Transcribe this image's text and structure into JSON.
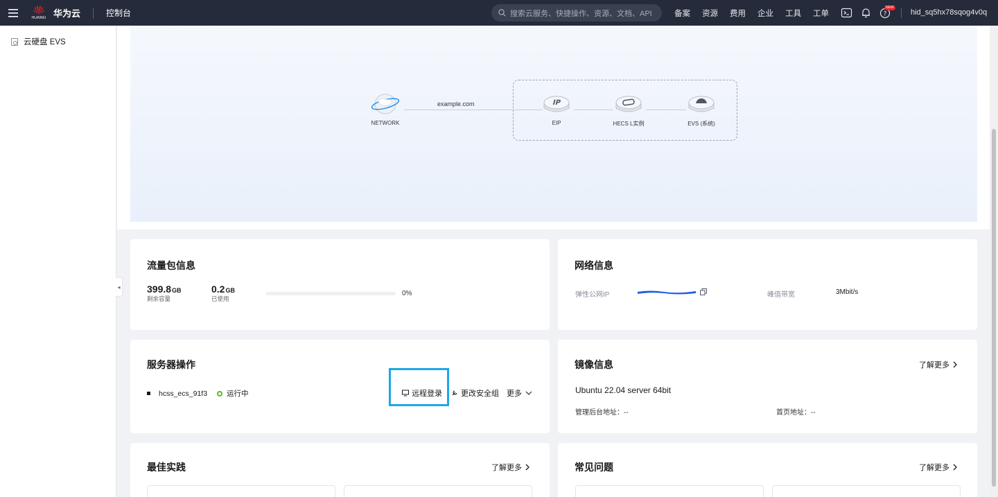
{
  "topbar": {
    "brand": "华为云",
    "logo_text": "HUAWEI",
    "console": "控制台",
    "search_placeholder": "搜索云服务、快捷操作、资源、文档、API",
    "nav": [
      "备案",
      "资源",
      "费用",
      "企业",
      "工具",
      "工单"
    ],
    "new_badge": "NEW",
    "user": "hid_sq5hx78sqog4v0q"
  },
  "sidebar": {
    "items": [
      {
        "label": "云硬盘 EVS",
        "icon": "disk-icon"
      }
    ],
    "collapse_glyph": "◂"
  },
  "topology": {
    "domain": "example.com",
    "nodes": [
      {
        "label": "NETWORK",
        "icon": "globe-icon"
      },
      {
        "label": "EIP",
        "icon": "ip-icon"
      },
      {
        "label": "HECS L实例",
        "icon": "server-icon"
      },
      {
        "label": "EVS (系统)",
        "icon": "disk-icon"
      }
    ]
  },
  "traffic": {
    "title": "流量包信息",
    "remaining_value": "399.8",
    "remaining_unit": "GB",
    "remaining_label": "剩余容量",
    "used_value": "0.2",
    "used_unit": "GB",
    "used_label": "已使用",
    "percent": "0%",
    "usage_fraction": 0
  },
  "network": {
    "title": "网络信息",
    "eip_label": "弹性公网IP",
    "bandwidth_label": "峰值带宽",
    "bandwidth_value": "3Mbit/s"
  },
  "server_ops": {
    "title": "服务器操作",
    "server_name": "hcss_ecs_91f3",
    "status": "运行中",
    "remote_login": "远程登录",
    "change_sg": "更改安全组",
    "more": "更多"
  },
  "image_info": {
    "title": "镜像信息",
    "more_link": "了解更多",
    "os": "Ubuntu 22.04 server 64bit",
    "admin_label": "管理后台地址：",
    "admin_value": "--",
    "home_label": "首页地址：",
    "home_value": "--"
  },
  "best_practice": {
    "title": "最佳实践",
    "more_link": "了解更多"
  },
  "faq": {
    "title": "常见问题",
    "more_link": "了解更多"
  },
  "colors": {
    "topbar": "#252b3a",
    "highlight": "#1aa7e8",
    "running": "#5ab92a"
  }
}
